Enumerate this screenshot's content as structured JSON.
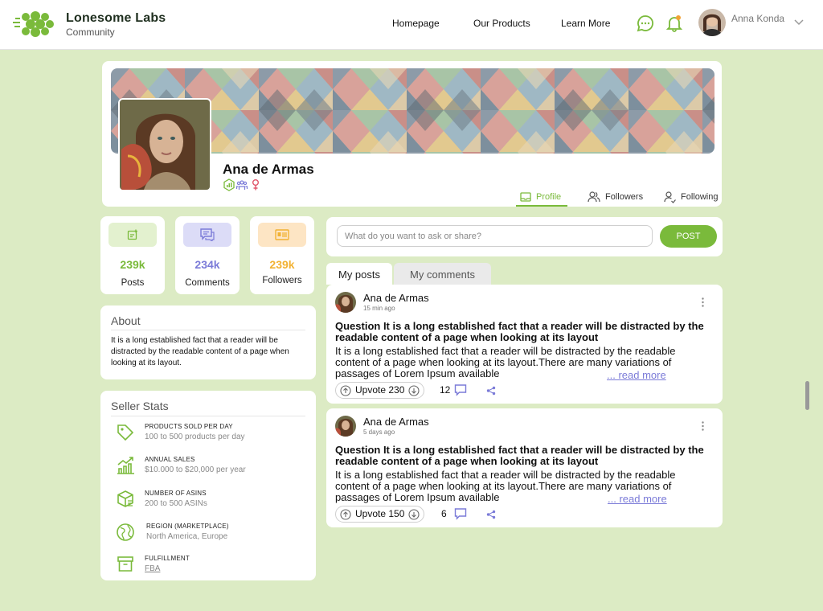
{
  "brand": {
    "name": "Lonesome Labs",
    "sub": "Community"
  },
  "nav": {
    "home": "Homepage",
    "products": "Our Products",
    "learn": "Learn More"
  },
  "user": {
    "name": "Anna Konda"
  },
  "profile": {
    "name": "Ana de Armas",
    "tabs": [
      "Profile",
      "Followers",
      "Following"
    ]
  },
  "stats": [
    {
      "value": "239k",
      "label": "Posts",
      "color": "#7aba3b",
      "chip": "#e3f1cf"
    },
    {
      "value": "234k",
      "label": "Comments",
      "color": "#7b7bd8",
      "chip": "#dcdcf7"
    },
    {
      "value": "239k",
      "label": "Followers",
      "color": "#f2b233",
      "chip": "#fde5c4"
    }
  ],
  "about": {
    "title": "About",
    "text": "It is a long established fact that a reader will be distracted by the readable content of a page when looking at its layout."
  },
  "seller": {
    "title": "Seller Stats",
    "items": [
      {
        "label": "PRODUCTS SOLD PER DAY",
        "value": "100 to 500 products per day",
        "icon": "tag-icon"
      },
      {
        "label": "ANNUAL SALES",
        "value": "$10.000 to $20,000 per year",
        "icon": "bar-chart-icon"
      },
      {
        "label": "NUMBER OF ASINS",
        "value": "200 to 500 ASINs",
        "icon": "box-icon"
      },
      {
        "label": "REGION (MARKETPLACE)",
        "value": "North America, Europe",
        "icon": "globe-icon"
      },
      {
        "label": "FULFILLMENT",
        "value": "FBA",
        "icon": "archive-icon"
      }
    ]
  },
  "composer": {
    "placeholder": "What do you want to ask or share?",
    "button": "POST"
  },
  "feed_tabs": [
    "My posts",
    "My comments"
  ],
  "posts": [
    {
      "author": "Ana de Armas",
      "time": "15 min ago",
      "question": "Question It is a long established fact that a reader will be distracted by the readable content of a page when looking at its layout",
      "body": "It is a long established fact that a reader will be distracted by the readable content of a page when looking at its layout.There are many variations of passages of Lorem Ipsum available",
      "read_more": "... read more",
      "upvotes": "Upvote 230",
      "comments": "12"
    },
    {
      "author": "Ana de Armas",
      "time": "5 days ago",
      "question": "Question It is a long established fact that a reader will be distracted by the readable content of a page when looking at its layout",
      "body": "It is a long established fact that a reader will be distracted by the readable content of a page when looking at its layout.There are many variations of passages of Lorem Ipsum available",
      "read_more": "... read more",
      "upvotes": "Upvote 150",
      "comments": "6"
    }
  ],
  "colors": {
    "accent": "#7aba3b",
    "purple": "#7b7bd8",
    "orange": "#f2b233",
    "background": "#dcebc4"
  }
}
